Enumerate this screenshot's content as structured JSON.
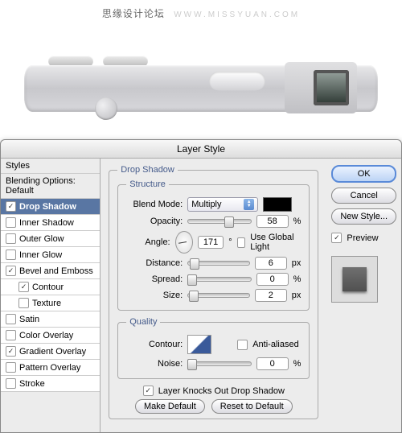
{
  "watermark": {
    "cn": "思缘设计论坛",
    "url": "WWW.MISSYUAN.COM"
  },
  "dialog": {
    "title": "Layer Style",
    "styles_header": "Styles",
    "blending_header": "Blending Options: Default",
    "items": [
      {
        "label": "Drop Shadow",
        "checked": true,
        "selected": true
      },
      {
        "label": "Inner Shadow",
        "checked": false
      },
      {
        "label": "Outer Glow",
        "checked": false
      },
      {
        "label": "Inner Glow",
        "checked": false
      },
      {
        "label": "Bevel and Emboss",
        "checked": true
      },
      {
        "label": "Contour",
        "checked": true,
        "indent": true
      },
      {
        "label": "Texture",
        "checked": false,
        "indent": true
      },
      {
        "label": "Satin",
        "checked": false
      },
      {
        "label": "Color Overlay",
        "checked": false
      },
      {
        "label": "Gradient Overlay",
        "checked": true
      },
      {
        "label": "Pattern Overlay",
        "checked": false
      },
      {
        "label": "Stroke",
        "checked": false
      }
    ]
  },
  "panel": {
    "title": "Drop Shadow",
    "structure": "Structure",
    "blend_mode_lbl": "Blend Mode:",
    "blend_mode_val": "Multiply",
    "opacity_lbl": "Opacity:",
    "opacity_val": "58",
    "pct": "%",
    "angle_lbl": "Angle:",
    "angle_val": "171",
    "deg": "°",
    "use_global": "Use Global Light",
    "distance_lbl": "Distance:",
    "distance_val": "6",
    "px": "px",
    "spread_lbl": "Spread:",
    "spread_val": "0",
    "size_lbl": "Size:",
    "size_val": "2",
    "quality": "Quality",
    "contour_lbl": "Contour:",
    "antialiased": "Anti-aliased",
    "noise_lbl": "Noise:",
    "noise_val": "0",
    "knockout": "Layer Knocks Out Drop Shadow",
    "make_default": "Make Default",
    "reset_default": "Reset to Default"
  },
  "buttons": {
    "ok": "OK",
    "cancel": "Cancel",
    "new_style": "New Style...",
    "preview": "Preview"
  }
}
